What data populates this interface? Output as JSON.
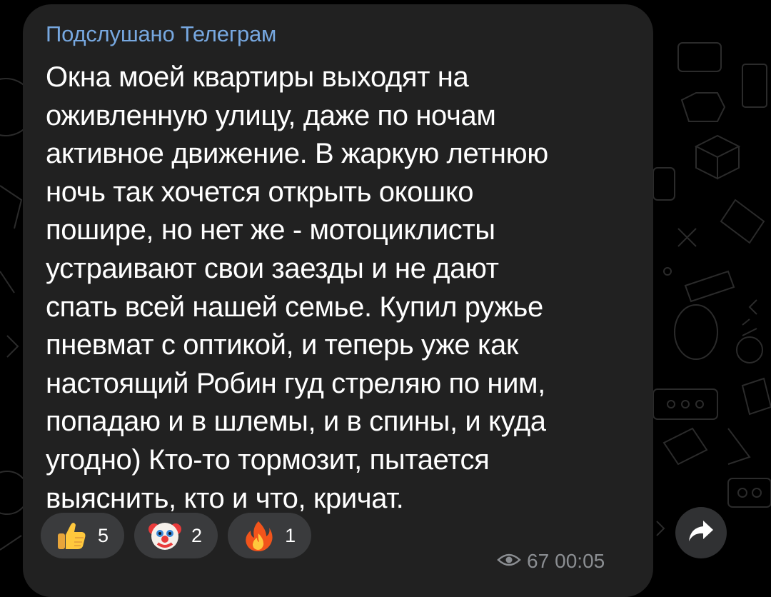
{
  "message": {
    "channel_name": "Подслушано Телеграм",
    "text": "Окна моей квартиры выходят на\nоживленную улицу, даже по ночам\nактивное движение. В жаркую летнюю\nночь так хочется открыть окошко\nпошире, но нет же - мотоциклисты\nустраивают свои заезды и не дают\nспать всей нашей семье. Купил ружье\nпневмат с оптикой, и теперь уже как\nнастоящий Робин гуд стреляю по ним,\nпопадаю и в шлемы, и в спины, и куда\nугодно) Кто-то тормозит, пытается\nвыяснить, кто и что, кричат.",
    "views": "67",
    "time": "00:05"
  },
  "reactions": [
    {
      "icon": "thumbs-up-icon",
      "count": "5"
    },
    {
      "icon": "clown-face-icon",
      "count": "2"
    },
    {
      "icon": "fire-icon",
      "count": "1"
    }
  ],
  "colors": {
    "background": "#000000",
    "bubble": "#212121",
    "channel_name": "#77a8e0",
    "text": "#ffffff",
    "reaction_bg": "#3a3b3d",
    "meta": "#8b8e92"
  },
  "icons": {
    "views": "eye-icon",
    "forward": "forward-arrow-icon"
  }
}
